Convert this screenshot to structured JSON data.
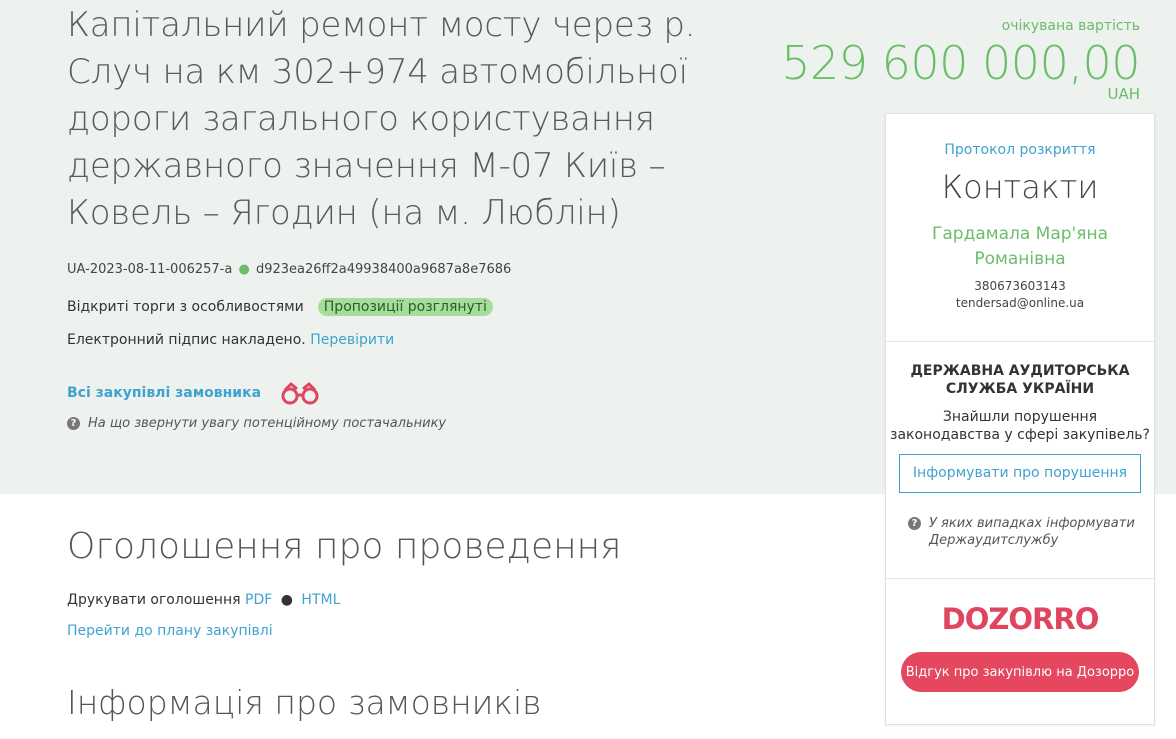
{
  "tender": {
    "title": "Капітальний ремонт мосту через р. Случ на км 302+974 автомобільної дороги загального користування державного значення М-07 Київ – Ковель – Ягодин (на м. Люблін)",
    "id": "UA-2023-08-11-006257-a",
    "hash": "d923ea26ff2a49938400a9687a8e7686",
    "procedure": "Відкриті торги з особливостями",
    "status_badge": "Пропозиції розглянуті",
    "signature_text": "Електронний підпис накладено.",
    "verify_link": "Перевірити",
    "all_purchases_link": "Всі закупівлі замовника",
    "supplier_hint": "На що звернути увагу потенційному постачальнику"
  },
  "cost": {
    "label": "очікувана вартість",
    "value": "529 600 000,00",
    "currency": "UAH"
  },
  "sidebar": {
    "protocol_link": "Протокол розкриття",
    "contacts_title": "Контакти",
    "contact_person": "Гардамала Мар'яна Романівна",
    "phone": "380673603143",
    "email": "tendersad@online.ua",
    "audit_title": "ДЕРЖАВНА АУДИТОРСЬКА СЛУЖБА УКРАЇНИ",
    "audit_question": "Знайшли порушення законодавства у сфері закупівель?",
    "report_button": "Інформувати про порушення",
    "audit_hint": "У яких випадках інформувати Держаудитслужбу",
    "dozorro_logo": "DOZORRO",
    "dozorro_button": "Відгук про закупівлю на Дозорро"
  },
  "main": {
    "announce_heading": "Оголошення про проведення",
    "print_label": "Друкувати оголошення",
    "print_pdf": "PDF",
    "print_separator": "●",
    "print_html": "HTML",
    "plan_link": "Перейти до плану закупівлі",
    "customers_heading": "Інформація про замовників"
  },
  "colors": {
    "accent_green": "#6cbd6a",
    "link_blue": "#3fa3cf",
    "dozorro_red": "#e4475e",
    "band_bg": "#edf2ef"
  }
}
